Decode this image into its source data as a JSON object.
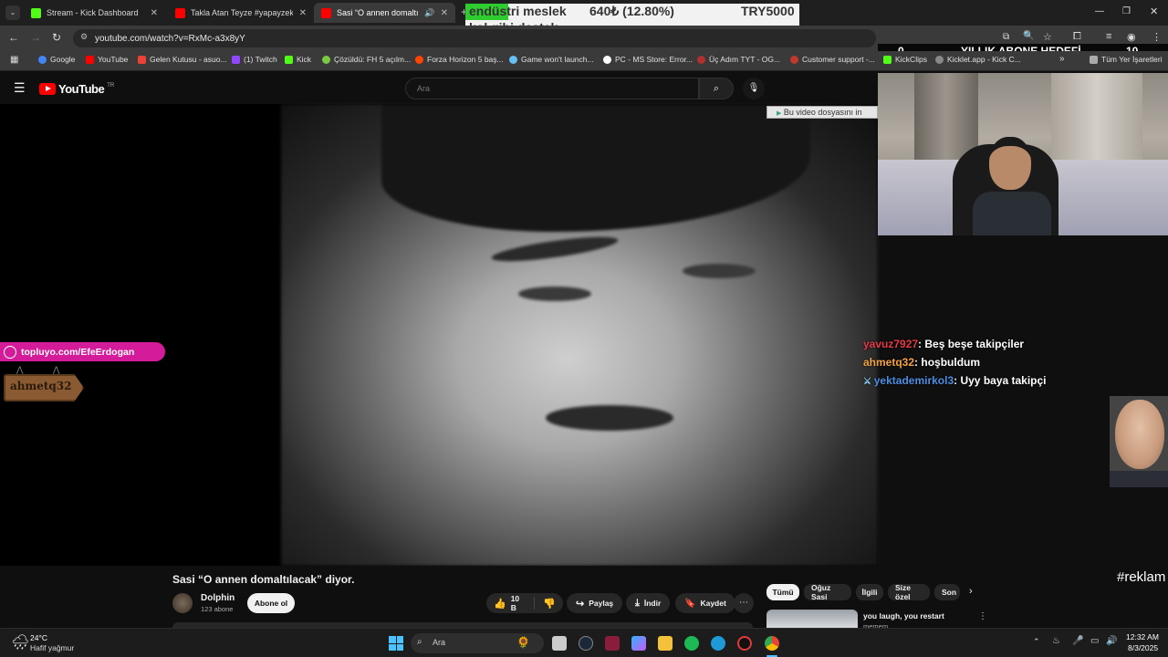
{
  "browser": {
    "tabs": [
      {
        "title": "Stream - Kick Dashboard",
        "color": "#53fc18"
      },
      {
        "title": "Takla Atan Teyze #yapayzeka #",
        "color": "#ff0000"
      },
      {
        "title": "Sasi “O annen domaltılacak",
        "color": "#ff0000"
      }
    ],
    "url": "youtube.com/watch?v=RxMc-a3x8yY",
    "bookmarks": [
      {
        "label": "Google",
        "color": "#4285f4"
      },
      {
        "label": "YouTube",
        "color": "#ff0000"
      },
      {
        "label": "Gelen Kutusu - asuo...",
        "color": "#ea4335"
      },
      {
        "label": "(1) Twitch",
        "color": "#9146ff"
      },
      {
        "label": "Kick",
        "color": "#53fc18"
      },
      {
        "label": "Çözüldü: FH 5 açılm...",
        "color": "#7ac943"
      },
      {
        "label": "Forza Horizon 5 baş...",
        "color": "#ff4500"
      },
      {
        "label": "Game won't launch...",
        "color": "#66c0f4"
      },
      {
        "label": "PC - MS Store: Error...",
        "color": "#ffffff"
      },
      {
        "label": "Üç Adım TYT - OG...",
        "color": "#b03030"
      },
      {
        "label": "Customer support -...",
        "color": "#c0392b"
      },
      {
        "label": "KickClips",
        "color": "#53fc18"
      },
      {
        "label": "Kicklet.app - Kick C...",
        "color": "#888888"
      },
      {
        "label": "Tüm Yer İşaretleri",
        "color": "#aaaaaa"
      }
    ]
  },
  "ticker": {
    "line1_left": "endüstri meslek",
    "line1_mid": "640₺ (12.80%)",
    "line1_right": "TRY5000",
    "line2": "kol gibi destek",
    "progress_percent": 12.8
  },
  "sub_goal": {
    "current": "0",
    "label": "YILLIK ABONE HEDEFİ",
    "target": "10"
  },
  "youtube": {
    "logo": "YouTube",
    "region": "TR",
    "search_placeholder": "Ara",
    "download_banner": "Bu video dosyasını in",
    "video_title": "Sasi “O annen domaltılacak” diyor.",
    "channel_name": "Dolphin",
    "subscribers": "123 abone",
    "subscribe_label": "Abone ol",
    "likes": "10 B",
    "share_label": "Paylaş",
    "download_label": "İndir",
    "save_label": "Kaydet",
    "chips": [
      "Tümü",
      "Oğuz Sasi",
      "İlgili",
      "Size özel",
      "Son"
    ],
    "suggestion_title": "you laugh, you restart",
    "suggestion_channel": "memem"
  },
  "overlay": {
    "link": "topluyo.com/EfeErdogan",
    "sign_name": "ahmetq32",
    "hashtag": "#reklam"
  },
  "chat": [
    {
      "user": "yavuz7927",
      "message": ": Beş beşe takipçiler",
      "color": "#e63946"
    },
    {
      "user": "ahmetq32",
      "message": ": hoşbuldum",
      "color": "#f4a340"
    },
    {
      "user": "yektademirkol3",
      "message": ": Uyy baya takipçi",
      "color": "#4a90e2"
    }
  ],
  "taskbar": {
    "weather_temp": "24°C",
    "weather_desc": "Hafif yağmur",
    "search_label": "Ara",
    "time": "12:32 AM",
    "date": "8/3/2025"
  }
}
